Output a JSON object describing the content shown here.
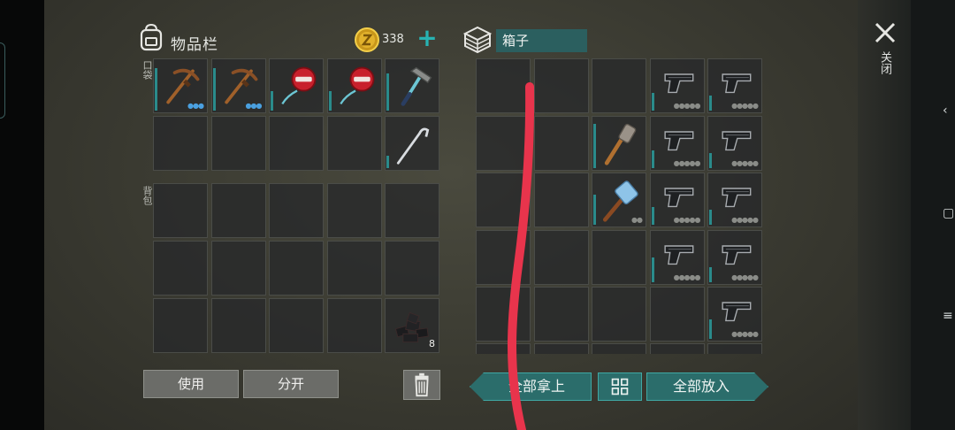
{
  "inventory": {
    "title": "物品栏",
    "coins": "338",
    "pocket_label": "口袋",
    "backpack_label": "背包",
    "pocket_slots": [
      {
        "item": "pickaxe-icon",
        "charge": 0.85,
        "dots": "blue"
      },
      {
        "item": "pickaxe-icon",
        "charge": 0.85,
        "dots": "blue"
      },
      {
        "item": "blocked-tool-icon",
        "charge": 0.4,
        "dots": ""
      },
      {
        "item": "blocked-tool-icon",
        "charge": 0.4,
        "dots": ""
      },
      {
        "item": "hammer-icon",
        "charge": 0.75,
        "dots": ""
      },
      {
        "item": "",
        "charge": 0,
        "dots": ""
      },
      {
        "item": "",
        "charge": 0,
        "dots": ""
      },
      {
        "item": "",
        "charge": 0,
        "dots": ""
      },
      {
        "item": "",
        "charge": 0,
        "dots": ""
      },
      {
        "item": "hook-tool-icon",
        "charge": 0.25,
        "dots": ""
      }
    ],
    "backpack_slots": [
      {
        "item": "",
        "count": ""
      },
      {
        "item": "",
        "count": ""
      },
      {
        "item": "",
        "count": ""
      },
      {
        "item": "",
        "count": ""
      },
      {
        "item": "",
        "count": ""
      },
      {
        "item": "",
        "count": ""
      },
      {
        "item": "",
        "count": ""
      },
      {
        "item": "",
        "count": ""
      },
      {
        "item": "",
        "count": ""
      },
      {
        "item": "",
        "count": ""
      },
      {
        "item": "",
        "count": ""
      },
      {
        "item": "",
        "count": ""
      },
      {
        "item": "",
        "count": ""
      },
      {
        "item": "",
        "count": ""
      },
      {
        "item": "coal-icon",
        "count": "8"
      }
    ],
    "use_label": "使用",
    "split_label": "分开"
  },
  "box": {
    "title": "箱子",
    "slots": [
      {
        "item": "",
        "charge": 0
      },
      {
        "item": "",
        "charge": 0
      },
      {
        "item": "",
        "charge": 0
      },
      {
        "item": "pistol-icon",
        "charge": 0.35
      },
      {
        "item": "pistol-icon",
        "charge": 0.3
      },
      {
        "item": "",
        "charge": 0
      },
      {
        "item": "",
        "charge": 0
      },
      {
        "item": "club-icon",
        "charge": 0.9
      },
      {
        "item": "pistol-icon",
        "charge": 0.35
      },
      {
        "item": "pistol-icon",
        "charge": 0.3
      },
      {
        "item": "",
        "charge": 0
      },
      {
        "item": "",
        "charge": 0
      },
      {
        "item": "sledgehammer-icon",
        "charge": 0.6
      },
      {
        "item": "pistol-icon",
        "charge": 0.35
      },
      {
        "item": "pistol-icon",
        "charge": 0.3
      },
      {
        "item": "",
        "charge": 0
      },
      {
        "item": "",
        "charge": 0
      },
      {
        "item": "",
        "charge": 0
      },
      {
        "item": "pistol-icon",
        "charge": 0.5
      },
      {
        "item": "pistol-icon",
        "charge": 0.3
      },
      {
        "item": "",
        "charge": 0
      },
      {
        "item": "",
        "charge": 0
      },
      {
        "item": "",
        "charge": 0
      },
      {
        "item": "",
        "charge": 0
      },
      {
        "item": "pistol-icon",
        "charge": 0.4
      }
    ],
    "take_all_label": "全部拿上",
    "put_all_label": "全部放入"
  },
  "close_label": "关闭",
  "colors": {
    "accent": "#2a8b8b",
    "teal_button": "#2b6d6b",
    "coin": "#d8a820",
    "stroke": "#e8344c"
  }
}
